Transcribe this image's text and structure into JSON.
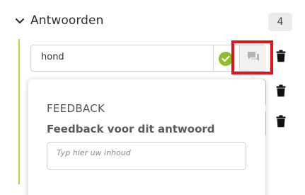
{
  "section": {
    "title": "Antwoorden",
    "count": "4",
    "toggle_icon": "chevron-down-icon"
  },
  "answers": [
    {
      "text": "hond",
      "status_icon": "check-circle-icon",
      "feedback_icon": "chat-bubbles-icon",
      "delete_icon": "trash-icon"
    },
    {
      "text": "",
      "delete_icon": "trash-icon"
    },
    {
      "text": "",
      "delete_icon": "trash-icon"
    }
  ],
  "feedback_popover": {
    "heading": "FEEDBACK",
    "label": "Feedback voor dit antwoord",
    "placeholder": "Typ hier uw inhoud"
  },
  "colors": {
    "accent_green": "#8fbe2c",
    "tree_line": "#b7d04e",
    "highlight_red": "#e3141b"
  }
}
